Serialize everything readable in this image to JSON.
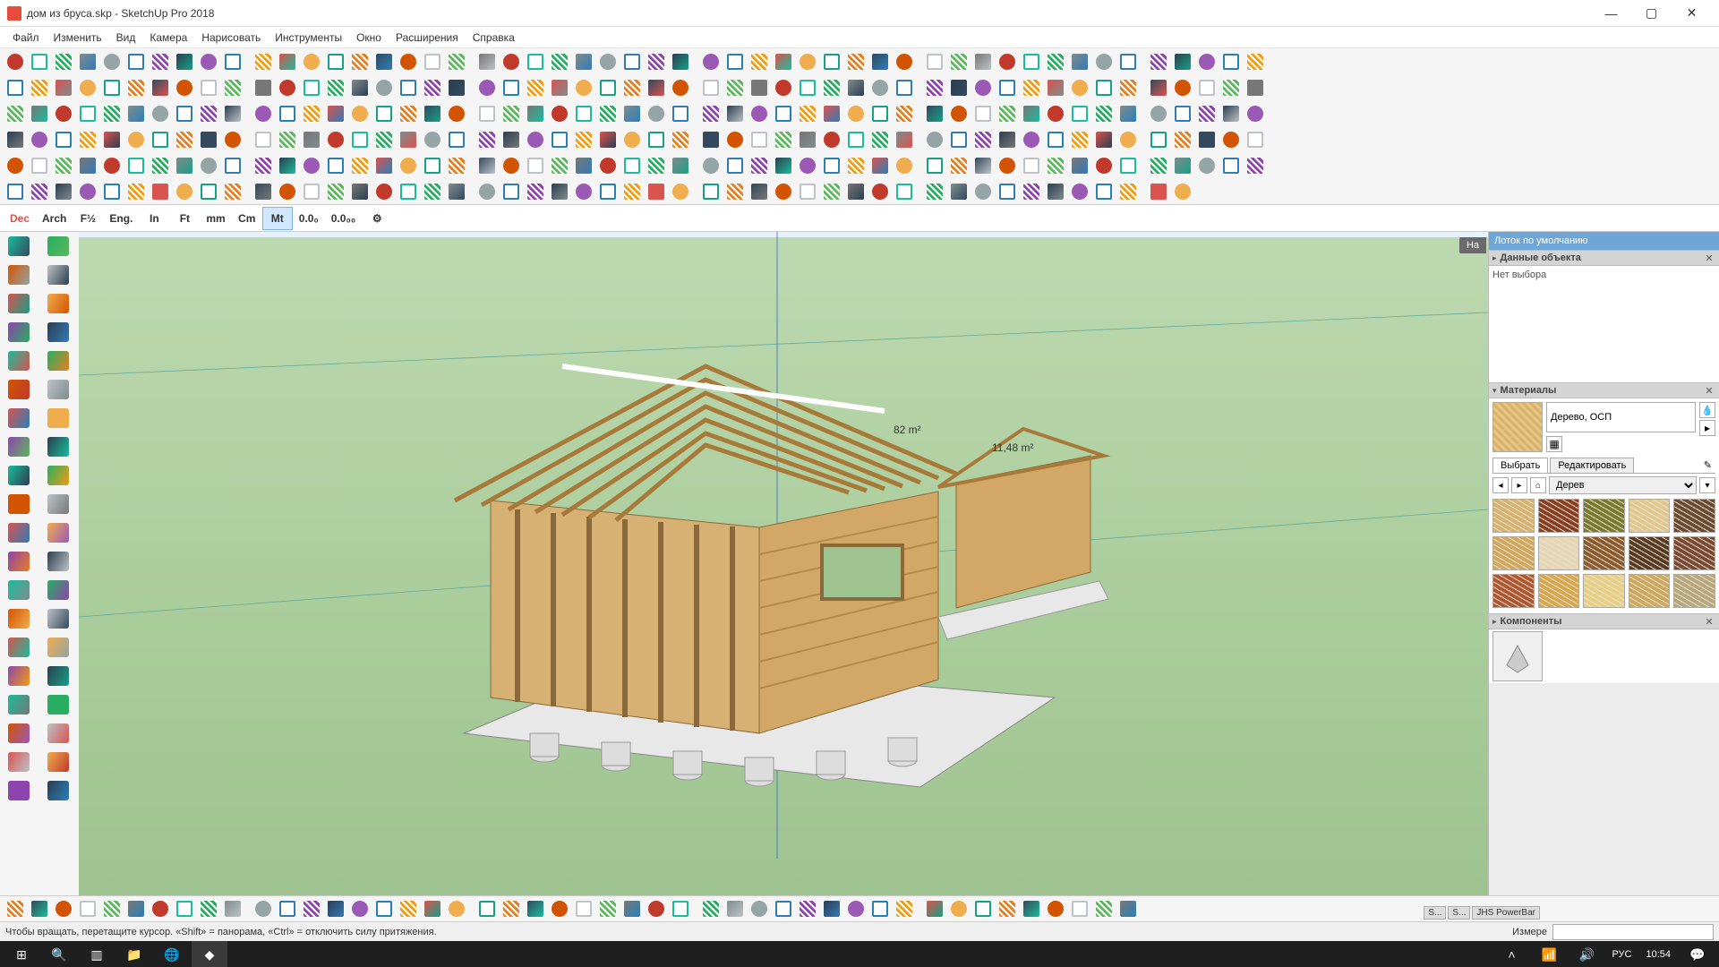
{
  "window": {
    "title": "дом из бруса.skp - SketchUp Pro 2018",
    "controls": {
      "minimize": "—",
      "maximize": "▢",
      "close": "✕"
    }
  },
  "menubar": [
    "Файл",
    "Изменить",
    "Вид",
    "Камера",
    "Нарисовать",
    "Инструменты",
    "Окно",
    "Расширения",
    "Справка"
  ],
  "units": {
    "items": [
      "Dec",
      "Arch",
      "F½",
      "Eng.",
      "In",
      "Ft",
      "mm",
      "Cm",
      "Mt",
      "0.0₀",
      "0.0₀₀"
    ],
    "active": "Mt"
  },
  "viewport": {
    "annotations_hint": "82 m²  · 11,48 m²",
    "instructor_tab": "На"
  },
  "tray": {
    "title": "Лоток по умолчанию",
    "object_info": {
      "title": "Данные объекта",
      "empty_text": "Нет выбора"
    },
    "materials": {
      "title": "Материалы",
      "current_name": "Дерево, ОСП",
      "tabs": {
        "select": "Выбрать",
        "edit": "Редактировать"
      },
      "library_select": "Дерев",
      "swatch_colors": [
        "#d9b36c",
        "#8b3e1e",
        "#7a7a2a",
        "#e2c98a",
        "#6b4a2e",
        "#d4a85a",
        "#e7d6b0",
        "#8e5a2a",
        "#5a3a1e",
        "#7b4a2e",
        "#b0562a",
        "#d9a64a",
        "#e8d080",
        "#cfa85a",
        "#b9a77a"
      ]
    },
    "components": {
      "title": "Компоненты"
    }
  },
  "statusbar": {
    "hint": "Чтобы вращать, перетащите курсор. «Shift» = панорама, «Ctrl» = отключить силу притяжения.",
    "measure_label": "Измере",
    "float_tabs": [
      "S...",
      "S...",
      "JHS PowerBar"
    ]
  },
  "taskbar": {
    "lang": "РУС",
    "time": "10:54"
  },
  "toolrows": [
    {
      "count": 51,
      "seed": 1
    },
    {
      "count": 51,
      "seed": 2
    },
    {
      "count": 51,
      "seed": 3
    },
    {
      "count": 51,
      "seed": 4
    },
    {
      "count": 51,
      "seed": 5
    },
    {
      "count": 48,
      "seed": 6
    }
  ],
  "bottomrow": {
    "count": 46,
    "seed": 7
  },
  "left_cols": [
    {
      "count": 20,
      "seed": 10
    },
    {
      "count": 20,
      "seed": 11
    }
  ],
  "tool_palette": [
    "#d9534f",
    "#5cb85c",
    "#337ab7",
    "#f0ad4e",
    "#777",
    "#8e44ad",
    "#16a085",
    "#c0392b",
    "#2c3e50",
    "#e67e22",
    "#1abc9c",
    "#9b59b6",
    "#34495e",
    "#27ae60",
    "#2980b9",
    "#d35400",
    "#7f8c8d",
    "#f39c12",
    "#bdc3c7",
    "#95a5a6"
  ]
}
